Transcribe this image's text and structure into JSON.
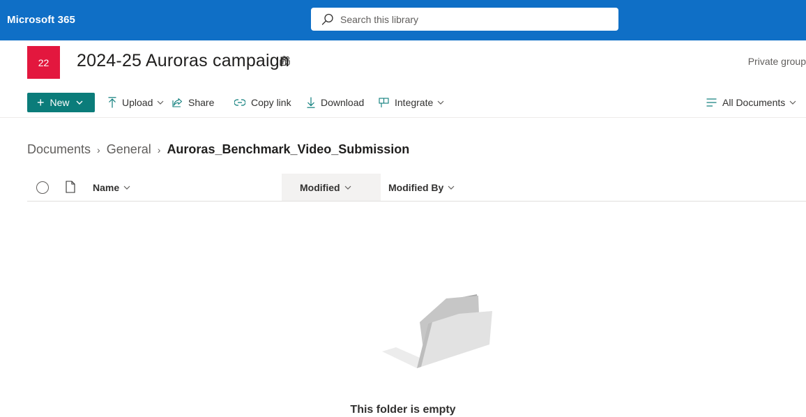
{
  "suite": {
    "title": "Microsoft 365",
    "search_placeholder": "Search this library",
    "color": "#0f6fc6"
  },
  "site": {
    "logo_text": "22",
    "logo_color": "#e3173e",
    "title": "2024-25 Auroras campaign",
    "privacy": "Private group"
  },
  "command_bar": {
    "new_label": "New",
    "new_color": "#0b7c7a",
    "upload_label": "Upload",
    "share_label": "Share",
    "copy_link_label": "Copy link",
    "download_label": "Download",
    "integrate_label": "Integrate",
    "view_label": "All Documents"
  },
  "breadcrumb": {
    "items": [
      "Documents",
      "General"
    ],
    "current": "Auroras_Benchmark_Video_Submission"
  },
  "columns": {
    "name": "Name",
    "modified": "Modified",
    "modified_by": "Modified By"
  },
  "empty_state": {
    "message": "This folder is empty"
  },
  "icons": [
    "search-icon",
    "teams-icon",
    "plus-icon",
    "upload-icon",
    "share-icon",
    "link-icon",
    "download-icon",
    "integrate-icon",
    "view-list-icon",
    "select-all-circle-icon",
    "file-type-icon",
    "chevron-down-icon",
    "empty-folder-illustration"
  ]
}
